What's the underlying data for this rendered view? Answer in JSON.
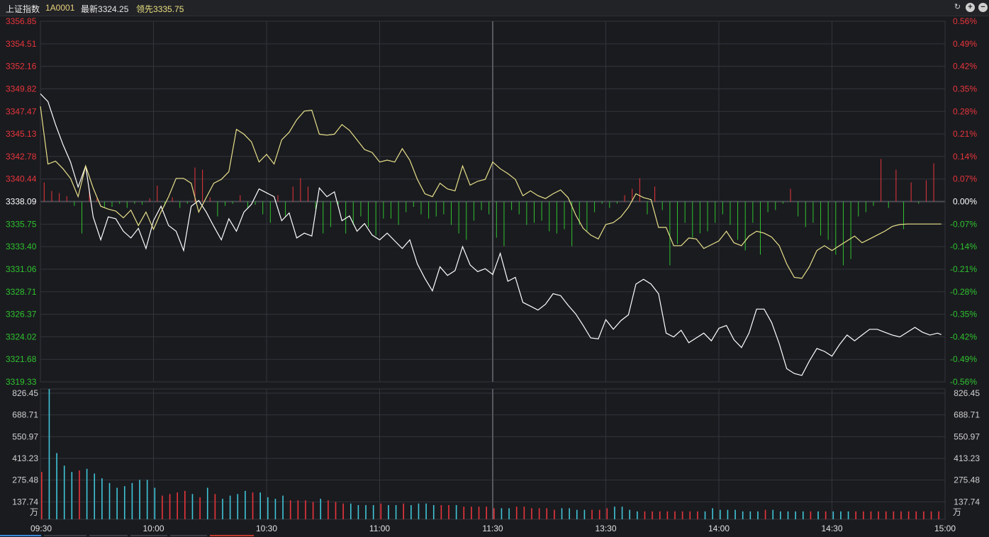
{
  "header": {
    "title": "上证指数",
    "code": "1A0001",
    "latest_label": "最新",
    "latest_value": "3324.25",
    "lead_label": "领先",
    "lead_value": "3335.75"
  },
  "toolbar": {
    "icons": [
      "refresh-icon",
      "zoom-in-icon",
      "zoom-out-icon"
    ]
  },
  "colors": {
    "background": "#1a1b1f",
    "grid": "#33353b",
    "up": "#e8353b",
    "down": "#2ec22e",
    "neutral": "#ffffff",
    "price_line": "#ffffff",
    "lead_line": "#e8e08a",
    "volume_cyan": "#3fc6d9",
    "volume_red": "#e8353b"
  },
  "chart_data": [
    {
      "type": "line",
      "name": "price-panel",
      "prev_close": 3338.09,
      "ylim": [
        3319.33,
        3356.85
      ],
      "xlim": [
        0,
        240
      ],
      "y_tick_labels": [
        "3356.85",
        "3354.51",
        "3352.16",
        "3349.82",
        "3347.47",
        "3345.13",
        "3342.78",
        "3340.44",
        "3338.09",
        "3335.75",
        "3333.40",
        "3331.06",
        "3328.71",
        "3326.37",
        "3324.02",
        "3321.68",
        "3319.33"
      ],
      "pct_tick_labels": [
        "0.56%",
        "0.49%",
        "0.42%",
        "0.35%",
        "0.28%",
        "0.21%",
        "0.14%",
        "0.07%",
        "0.00%",
        "-0.07%",
        "-0.14%",
        "-0.21%",
        "-0.28%",
        "-0.35%",
        "-0.42%",
        "-0.49%",
        "-0.56%"
      ],
      "time_labels": [
        "09:30",
        "10:00",
        "10:30",
        "11:00",
        "11:30",
        "13:30",
        "14:00",
        "14:30",
        "15:00"
      ],
      "series": [
        {
          "key": "price",
          "x": [
            0,
            2,
            4,
            6,
            8,
            10,
            12,
            14,
            16,
            18,
            20,
            22,
            24,
            26,
            28,
            30,
            32,
            34,
            36,
            38,
            40,
            42,
            44,
            46,
            48,
            50,
            52,
            54,
            56,
            58,
            60,
            62,
            64,
            66,
            68,
            70,
            72,
            74,
            76,
            78,
            80,
            82,
            84,
            86,
            88,
            90,
            92,
            94,
            96,
            98,
            100,
            102,
            104,
            106,
            108,
            110,
            112,
            114,
            116,
            118,
            120,
            122,
            124,
            126,
            128,
            130,
            132,
            134,
            136,
            138,
            140,
            142,
            144,
            146,
            148,
            150,
            152,
            154,
            156,
            158,
            160,
            162,
            164,
            166,
            168,
            170,
            172,
            174,
            176,
            178,
            180,
            182,
            184,
            186,
            188,
            190,
            192,
            194,
            196,
            198,
            200,
            202,
            204,
            206,
            208,
            210,
            212,
            214,
            216,
            218,
            220,
            222,
            224,
            226,
            228,
            230,
            232,
            234,
            236,
            238,
            239
          ],
          "values": [
            3349.3,
            3348.5,
            3346.1,
            3344.0,
            3342.2,
            3339.6,
            3341.8,
            3336.5,
            3334.1,
            3336.5,
            3336.3,
            3335.0,
            3334.3,
            3335.3,
            3333.2,
            3336.1,
            3337.6,
            3335.6,
            3335.0,
            3333.0,
            3337.6,
            3338.2,
            3337.0,
            3335.5,
            3334.1,
            3336.3,
            3335.0,
            3337.0,
            3337.8,
            3339.4,
            3339.0,
            3338.6,
            3336.1,
            3336.9,
            3334.3,
            3334.8,
            3334.5,
            3339.5,
            3338.6,
            3339.1,
            3336.1,
            3336.6,
            3335.0,
            3335.8,
            3334.6,
            3334.1,
            3334.8,
            3334.0,
            3333.2,
            3334.1,
            3331.6,
            3330.1,
            3328.8,
            3331.3,
            3330.4,
            3330.9,
            3333.4,
            3331.5,
            3330.8,
            3331.1,
            3330.5,
            3332.7,
            3329.8,
            3330.2,
            3327.6,
            3327.2,
            3326.8,
            3327.4,
            3328.5,
            3328.3,
            3327.3,
            3326.4,
            3325.2,
            3323.9,
            3323.8,
            3325.8,
            3324.8,
            3325.7,
            3326.3,
            3329.5,
            3330.0,
            3329.5,
            3328.5,
            3324.4,
            3324.0,
            3324.7,
            3323.4,
            3323.9,
            3324.4,
            3323.6,
            3324.9,
            3325.2,
            3323.7,
            3322.9,
            3324.4,
            3326.9,
            3326.9,
            3325.5,
            3323.3,
            3320.7,
            3320.2,
            3320.0,
            3321.5,
            3322.8,
            3322.5,
            3322.0,
            3323.2,
            3324.2,
            3323.6,
            3324.2,
            3324.8,
            3324.8,
            3324.5,
            3324.2,
            3324.0,
            3324.5,
            3325.0,
            3324.5,
            3324.2,
            3324.4,
            3324.25
          ]
        },
        {
          "key": "lead",
          "x": [
            0,
            2,
            4,
            6,
            8,
            10,
            12,
            14,
            16,
            18,
            20,
            22,
            24,
            26,
            28,
            30,
            32,
            34,
            36,
            38,
            40,
            42,
            44,
            46,
            48,
            50,
            52,
            54,
            56,
            58,
            60,
            62,
            64,
            66,
            68,
            70,
            72,
            74,
            76,
            78,
            80,
            82,
            84,
            86,
            88,
            90,
            92,
            94,
            96,
            98,
            100,
            102,
            104,
            106,
            108,
            110,
            112,
            114,
            116,
            118,
            120,
            122,
            124,
            126,
            128,
            130,
            132,
            134,
            136,
            138,
            140,
            142,
            144,
            146,
            148,
            150,
            152,
            154,
            156,
            158,
            160,
            162,
            164,
            166,
            168,
            170,
            172,
            174,
            176,
            178,
            180,
            182,
            184,
            186,
            188,
            190,
            192,
            194,
            196,
            198,
            200,
            202,
            204,
            206,
            208,
            210,
            212,
            214,
            216,
            218,
            220,
            222,
            224,
            226,
            228,
            230,
            232,
            234,
            236,
            238,
            239
          ],
          "values": [
            3348.0,
            3342.0,
            3342.3,
            3341.5,
            3340.5,
            3338.6,
            3341.8,
            3339.5,
            3337.6,
            3337.3,
            3337.1,
            3336.4,
            3337.2,
            3335.6,
            3337.0,
            3335.2,
            3337.0,
            3338.6,
            3340.5,
            3340.5,
            3340.0,
            3337.0,
            3338.5,
            3340.0,
            3340.4,
            3341.2,
            3345.6,
            3345.1,
            3344.3,
            3342.2,
            3343.0,
            3342.0,
            3344.5,
            3345.3,
            3346.6,
            3347.5,
            3347.6,
            3345.1,
            3345.0,
            3345.1,
            3346.1,
            3345.5,
            3344.5,
            3343.5,
            3343.2,
            3342.2,
            3342.4,
            3342.2,
            3343.6,
            3342.4,
            3340.4,
            3338.9,
            3338.6,
            3340.0,
            3339.4,
            3339.2,
            3341.8,
            3339.8,
            3340.2,
            3340.4,
            3342.2,
            3341.5,
            3341.0,
            3340.4,
            3338.7,
            3339.2,
            3338.7,
            3338.4,
            3338.9,
            3339.3,
            3338.5,
            3336.7,
            3335.3,
            3334.6,
            3334.2,
            3335.7,
            3335.9,
            3336.5,
            3337.5,
            3338.9,
            3338.5,
            3338.3,
            3335.4,
            3335.4,
            3333.5,
            3333.5,
            3334.3,
            3334.2,
            3333.2,
            3333.6,
            3334.0,
            3335.0,
            3333.8,
            3333.5,
            3334.5,
            3335.0,
            3334.8,
            3334.4,
            3333.5,
            3331.6,
            3330.2,
            3330.1,
            3331.3,
            3333.0,
            3333.5,
            3333.0,
            3333.5,
            3334.0,
            3334.5,
            3333.8,
            3334.2,
            3334.6,
            3335.0,
            3335.5,
            3335.7,
            3335.75,
            3335.75,
            3335.75,
            3335.75,
            3335.75,
            3335.75
          ]
        }
      ],
      "intensity_bars": {
        "x": [
          1,
          3,
          5,
          7,
          9,
          11,
          13,
          15,
          17,
          19,
          21,
          23,
          25,
          27,
          29,
          31,
          33,
          35,
          37,
          39,
          41,
          43,
          45,
          47,
          49,
          51,
          53,
          55,
          57,
          59,
          61,
          63,
          65,
          67,
          69,
          71,
          73,
          75,
          77,
          79,
          81,
          83,
          85,
          87,
          89,
          91,
          93,
          95,
          97,
          99,
          101,
          103,
          105,
          107,
          109,
          111,
          113,
          115,
          117,
          119,
          121,
          123,
          125,
          127,
          129,
          131,
          133,
          135,
          137,
          139,
          141,
          143,
          145,
          147,
          149,
          151,
          153,
          155,
          157,
          159,
          161,
          163,
          165,
          167,
          169,
          171,
          173,
          175,
          177,
          179,
          181,
          183,
          185,
          187,
          189,
          191,
          193,
          195,
          197,
          199,
          201,
          203,
          205,
          207,
          209,
          211,
          213,
          215,
          217,
          219,
          221,
          223,
          225,
          227,
          229,
          231,
          233,
          235,
          237
        ],
        "values": [
          18,
          10,
          8,
          5,
          -4,
          -30,
          12,
          3,
          -6,
          -5,
          -2,
          -6,
          -2,
          -3,
          3,
          15,
          -4,
          4,
          -6,
          -2,
          32,
          30,
          4,
          -14,
          -4,
          -2,
          6,
          -6,
          -3,
          -12,
          -20,
          6,
          -14,
          14,
          22,
          14,
          -7,
          -30,
          -24,
          -3,
          -30,
          -22,
          -14,
          -24,
          -32,
          -16,
          -16,
          -22,
          -10,
          -5,
          -12,
          -16,
          -14,
          -12,
          -22,
          -30,
          -36,
          -18,
          -8,
          -12,
          -34,
          -42,
          -8,
          -12,
          -22,
          -20,
          -18,
          -28,
          -30,
          -26,
          -42,
          -22,
          -28,
          -10,
          -2,
          -6,
          -2,
          6,
          12,
          22,
          -12,
          14,
          -8,
          -60,
          -40,
          -20,
          -34,
          -30,
          -28,
          -20,
          -12,
          -22,
          -36,
          -46,
          -20,
          -50,
          -10,
          -8,
          -2,
          12,
          -14,
          -24,
          -20,
          -32,
          -36,
          -50,
          -60,
          -54,
          -14,
          -10,
          -4,
          40,
          -6,
          30,
          -26,
          18,
          -2,
          20,
          36
        ],
        "unit": "relative"
      }
    },
    {
      "type": "bar",
      "name": "volume-panel",
      "ylim": [
        0,
        826.45
      ],
      "xlim": [
        0,
        240
      ],
      "y_tick_labels": [
        "826.45",
        "688.71",
        "550.97",
        "413.23",
        "275.48",
        "137.74"
      ],
      "unit_label": "万",
      "x": [
        0,
        2,
        4,
        6,
        8,
        10,
        12,
        14,
        16,
        18,
        20,
        22,
        24,
        26,
        28,
        30,
        32,
        34,
        36,
        38,
        40,
        42,
        44,
        46,
        48,
        50,
        52,
        54,
        56,
        58,
        60,
        62,
        64,
        66,
        68,
        70,
        72,
        74,
        76,
        78,
        80,
        82,
        84,
        86,
        88,
        90,
        92,
        94,
        96,
        98,
        100,
        102,
        104,
        106,
        108,
        110,
        112,
        114,
        116,
        118,
        120,
        122,
        124,
        126,
        128,
        130,
        132,
        134,
        136,
        138,
        140,
        142,
        144,
        146,
        148,
        150,
        152,
        154,
        156,
        158,
        160,
        162,
        164,
        166,
        168,
        170,
        172,
        174,
        176,
        178,
        180,
        182,
        184,
        186,
        188,
        190,
        192,
        194,
        196,
        198,
        200,
        202,
        204,
        206,
        208,
        210,
        212,
        214,
        216,
        218,
        220,
        222,
        224,
        226,
        228,
        230,
        232,
        234,
        236,
        238
      ],
      "values": [
        300,
        826,
        420,
        340,
        300,
        310,
        320,
        290,
        260,
        230,
        200,
        210,
        230,
        250,
        250,
        200,
        150,
        160,
        170,
        180,
        160,
        140,
        200,
        160,
        130,
        150,
        160,
        180,
        170,
        170,
        140,
        130,
        150,
        120,
        120,
        120,
        110,
        130,
        120,
        110,
        100,
        100,
        90,
        90,
        90,
        100,
        90,
        90,
        100,
        90,
        100,
        100,
        90,
        90,
        90,
        90,
        80,
        80,
        80,
        80,
        70,
        70,
        70,
        80,
        80,
        70,
        70,
        70,
        60,
        70,
        70,
        60,
        60,
        60,
        60,
        70,
        80,
        80,
        60,
        50,
        50,
        50,
        50,
        50,
        50,
        50,
        50,
        50,
        50,
        70,
        60,
        60,
        60,
        50,
        50,
        50,
        60,
        60,
        50,
        50,
        50,
        50,
        50,
        50,
        50,
        50,
        50,
        50,
        50,
        50,
        50,
        50,
        50,
        50,
        50,
        50,
        50,
        50,
        50,
        50
      ],
      "colors": [
        "up",
        "cyan",
        "cyan",
        "cyan",
        "cyan",
        "up",
        "cyan",
        "cyan",
        "cyan",
        "cyan",
        "cyan",
        "cyan",
        "cyan",
        "cyan",
        "cyan",
        "cyan",
        "up",
        "up",
        "up",
        "up",
        "cyan",
        "up",
        "cyan",
        "up",
        "cyan",
        "cyan",
        "cyan",
        "cyan",
        "up",
        "cyan",
        "cyan",
        "cyan",
        "cyan",
        "up",
        "up",
        "up",
        "up",
        "cyan",
        "up",
        "up",
        "up",
        "cyan",
        "cyan",
        "cyan",
        "cyan",
        "up",
        "cyan",
        "cyan",
        "up",
        "cyan",
        "cyan",
        "cyan",
        "cyan",
        "up",
        "up",
        "cyan",
        "up",
        "up",
        "up",
        "up",
        "up",
        "cyan",
        "cyan",
        "up",
        "up",
        "up",
        "up",
        "up",
        "up",
        "cyan",
        "cyan",
        "cyan",
        "cyan",
        "up",
        "up",
        "up",
        "cyan",
        "cyan",
        "cyan",
        "cyan",
        "up",
        "up",
        "up",
        "up",
        "up",
        "up",
        "up",
        "up",
        "cyan",
        "cyan",
        "cyan",
        "cyan",
        "cyan",
        "cyan",
        "cyan",
        "cyan",
        "up",
        "cyan",
        "cyan",
        "cyan",
        "cyan",
        "cyan",
        "up",
        "cyan",
        "up",
        "cyan",
        "cyan",
        "cyan",
        "up",
        "up",
        "up",
        "up",
        "up",
        "up",
        "up",
        "up",
        "up",
        "up",
        "up",
        "up"
      ]
    }
  ]
}
